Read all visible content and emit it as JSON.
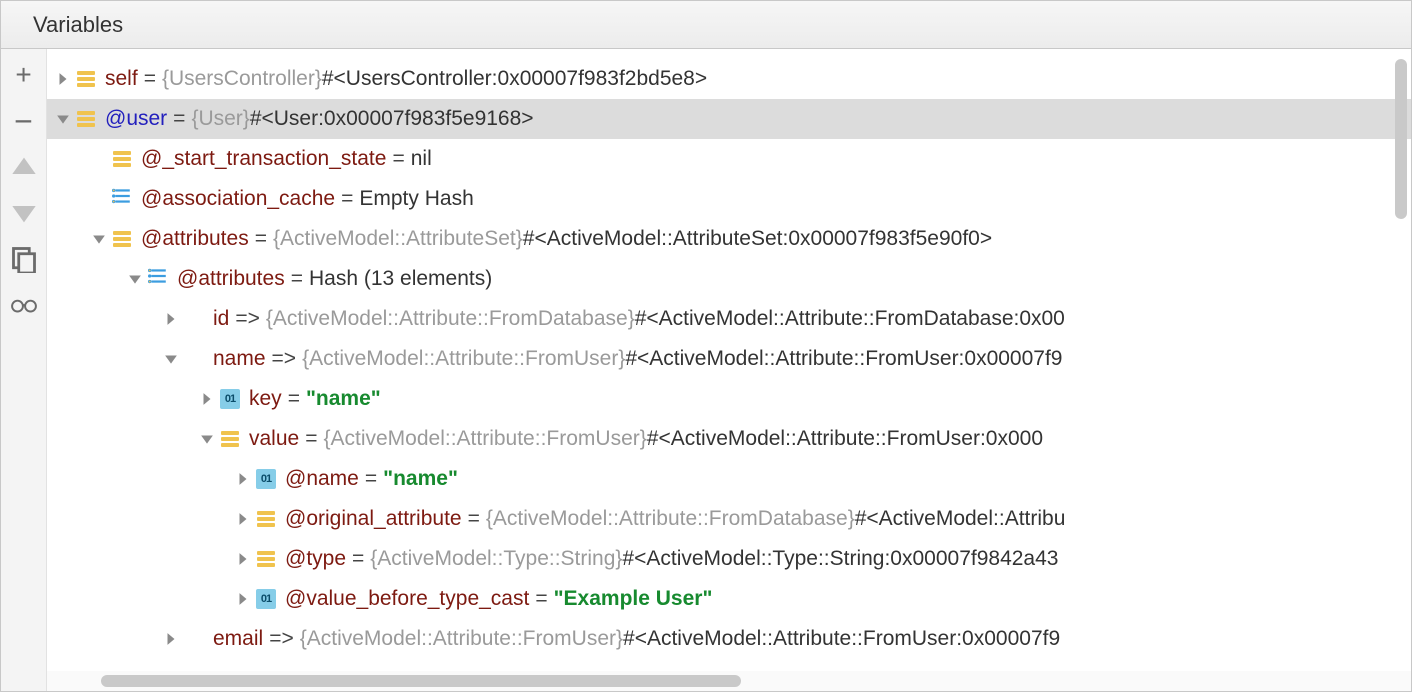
{
  "header": {
    "title": "Variables"
  },
  "sidebar": {
    "add": "+",
    "remove": "−"
  },
  "rows": [
    {
      "indent": 0,
      "twist": "right",
      "icon": "obj",
      "name": "self",
      "nameClass": "varname",
      "eq": " = ",
      "type": "{UsersController}",
      "repr": " #<UsersController:0x00007f983f2bd5e8>"
    },
    {
      "indent": 0,
      "twist": "down",
      "icon": "obj",
      "name": "@user",
      "nameClass": "varblue",
      "eq": " = ",
      "type": "{User}",
      "repr": " #<User:0x00007f983f5e9168>",
      "selected": true
    },
    {
      "indent": 1,
      "twist": "none",
      "icon": "obj",
      "name": "@_start_transaction_state",
      "nameClass": "varname",
      "eq": " = ",
      "repr": "nil"
    },
    {
      "indent": 1,
      "twist": "none",
      "icon": "hash",
      "name": "@association_cache",
      "nameClass": "varname",
      "eq": " = ",
      "repr": "Empty Hash"
    },
    {
      "indent": 1,
      "twist": "down",
      "icon": "obj",
      "name": "@attributes",
      "nameClass": "varname",
      "eq": " = ",
      "type": "{ActiveModel::AttributeSet}",
      "repr": " #<ActiveModel::AttributeSet:0x00007f983f5e90f0>"
    },
    {
      "indent": 2,
      "twist": "down",
      "icon": "hash",
      "name": "@attributes",
      "nameClass": "varname",
      "eq": " = ",
      "repr": "Hash (13 elements)"
    },
    {
      "indent": 3,
      "twist": "right",
      "icon": "none",
      "name": "id",
      "nameClass": "varname",
      "arrow": " => ",
      "type": "{ActiveModel::Attribute::FromDatabase}",
      "repr": " #<ActiveModel::Attribute::FromDatabase:0x00"
    },
    {
      "indent": 3,
      "twist": "down",
      "icon": "none",
      "name": "name",
      "nameClass": "varname",
      "arrow": " => ",
      "type": "{ActiveModel::Attribute::FromUser}",
      "repr": " #<ActiveModel::Attribute::FromUser:0x00007f9"
    },
    {
      "indent": 4,
      "twist": "right",
      "icon": "prim",
      "name": "key",
      "nameClass": "varname",
      "eq": " = ",
      "str": "\"name\""
    },
    {
      "indent": 4,
      "twist": "down",
      "icon": "obj",
      "name": "value",
      "nameClass": "varname",
      "eq": " = ",
      "type": "{ActiveModel::Attribute::FromUser}",
      "repr": " #<ActiveModel::Attribute::FromUser:0x000"
    },
    {
      "indent": 5,
      "twist": "right",
      "icon": "prim",
      "name": "@name",
      "nameClass": "varname",
      "eq": " = ",
      "str": "\"name\""
    },
    {
      "indent": 5,
      "twist": "right",
      "icon": "obj",
      "name": "@original_attribute",
      "nameClass": "varname",
      "eq": " = ",
      "type": "{ActiveModel::Attribute::FromDatabase}",
      "repr": " #<ActiveModel::Attribu"
    },
    {
      "indent": 5,
      "twist": "right",
      "icon": "obj",
      "name": "@type",
      "nameClass": "varname",
      "eq": " = ",
      "type": "{ActiveModel::Type::String}",
      "repr": " #<ActiveModel::Type::String:0x00007f9842a43"
    },
    {
      "indent": 5,
      "twist": "right",
      "icon": "prim",
      "name": "@value_before_type_cast",
      "nameClass": "varname",
      "eq": " = ",
      "str": "\"Example User\""
    },
    {
      "indent": 3,
      "twist": "right",
      "icon": "none",
      "name": "email",
      "nameClass": "varname",
      "arrow": " => ",
      "type": "{ActiveModel::Attribute::FromUser}",
      "repr": " #<ActiveModel::Attribute::FromUser:0x00007f9"
    }
  ]
}
